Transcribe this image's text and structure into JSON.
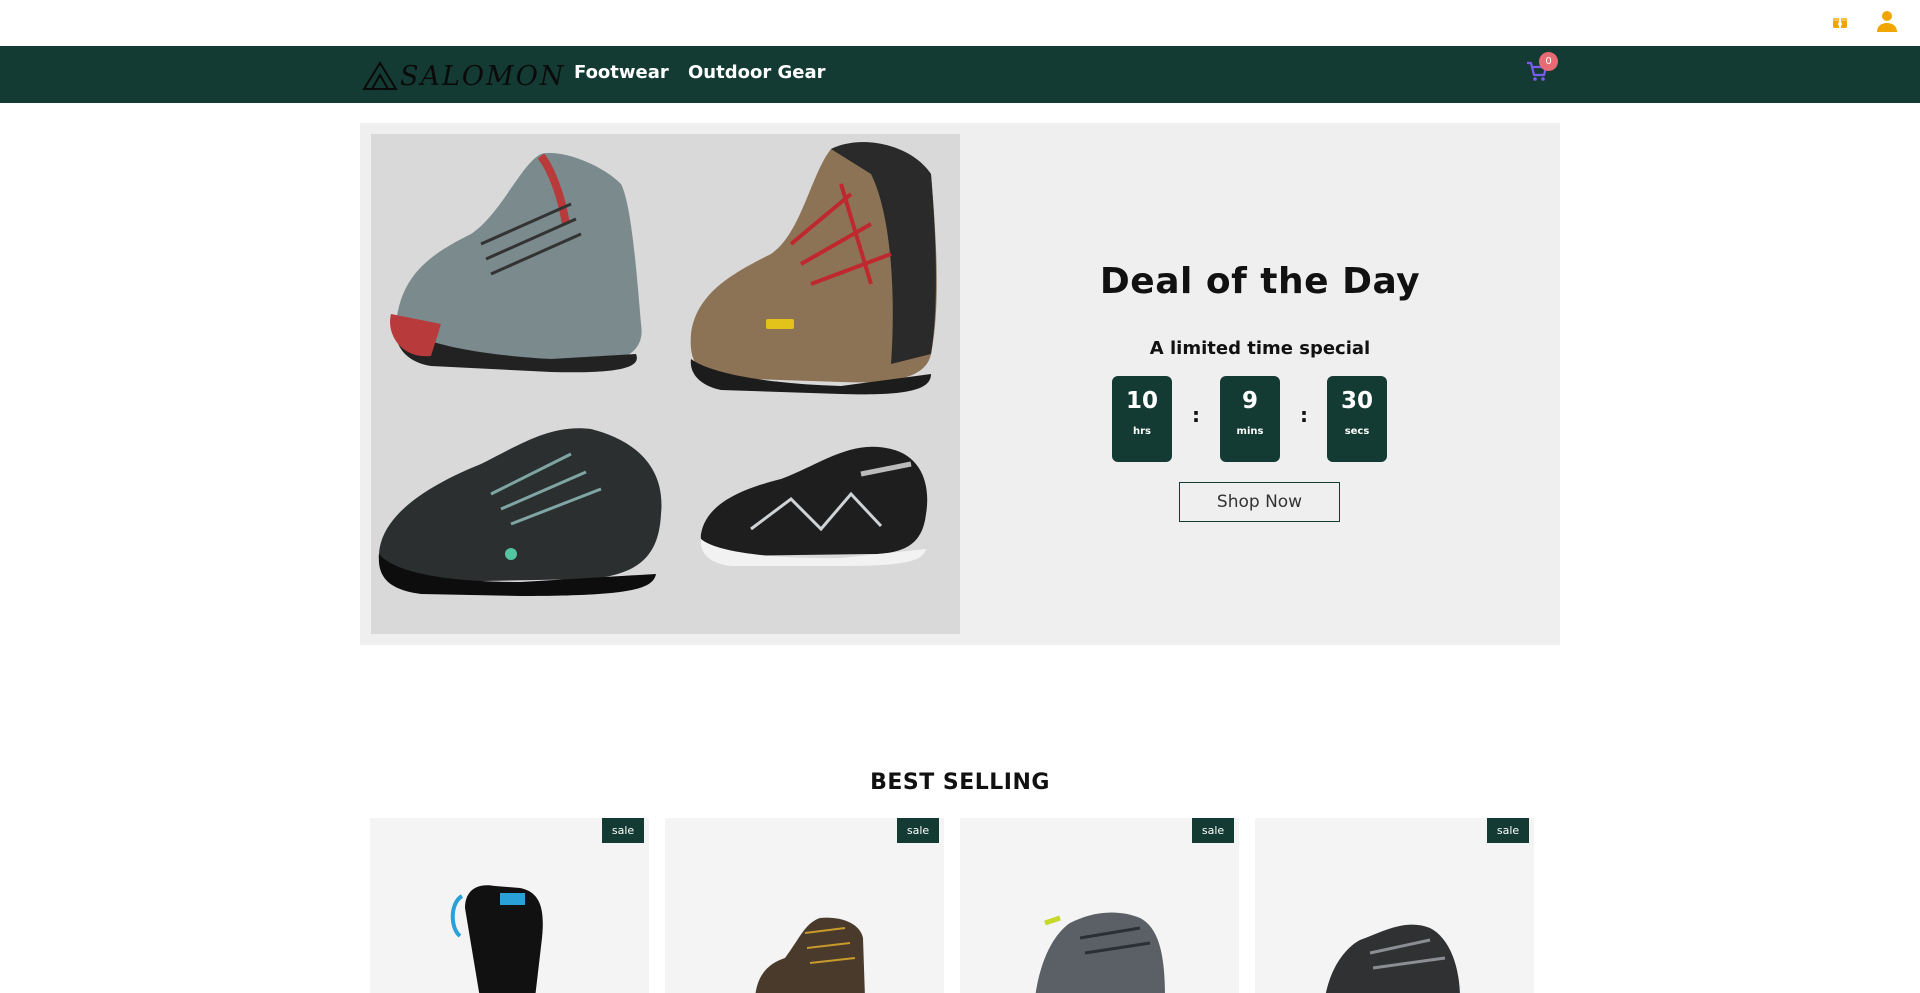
{
  "topbar": {
    "icons": [
      "gift-icon",
      "user-icon"
    ]
  },
  "brand": {
    "logo_text": "SALOMON"
  },
  "nav": {
    "links": [
      "Footwear",
      "Outdoor Gear"
    ],
    "cart_count": "0",
    "colors": {
      "nav_bg": "#143b33",
      "badge": "#e76b74",
      "accent": "#f0a500"
    }
  },
  "hero": {
    "title": "Deal of the Day",
    "subtitle": "A limited time special",
    "timer": [
      {
        "value": "10",
        "unit": "hrs"
      },
      {
        "value": "9",
        "unit": "mins"
      },
      {
        "value": "30",
        "unit": "secs"
      }
    ],
    "separator": ":",
    "button": "Shop Now"
  },
  "best_selling": {
    "title": "BEST SELLING",
    "badge": "sale",
    "products": [
      "hydration-pack",
      "hiking-boot",
      "trail-shoe-grey",
      "trail-shoe-black"
    ]
  }
}
